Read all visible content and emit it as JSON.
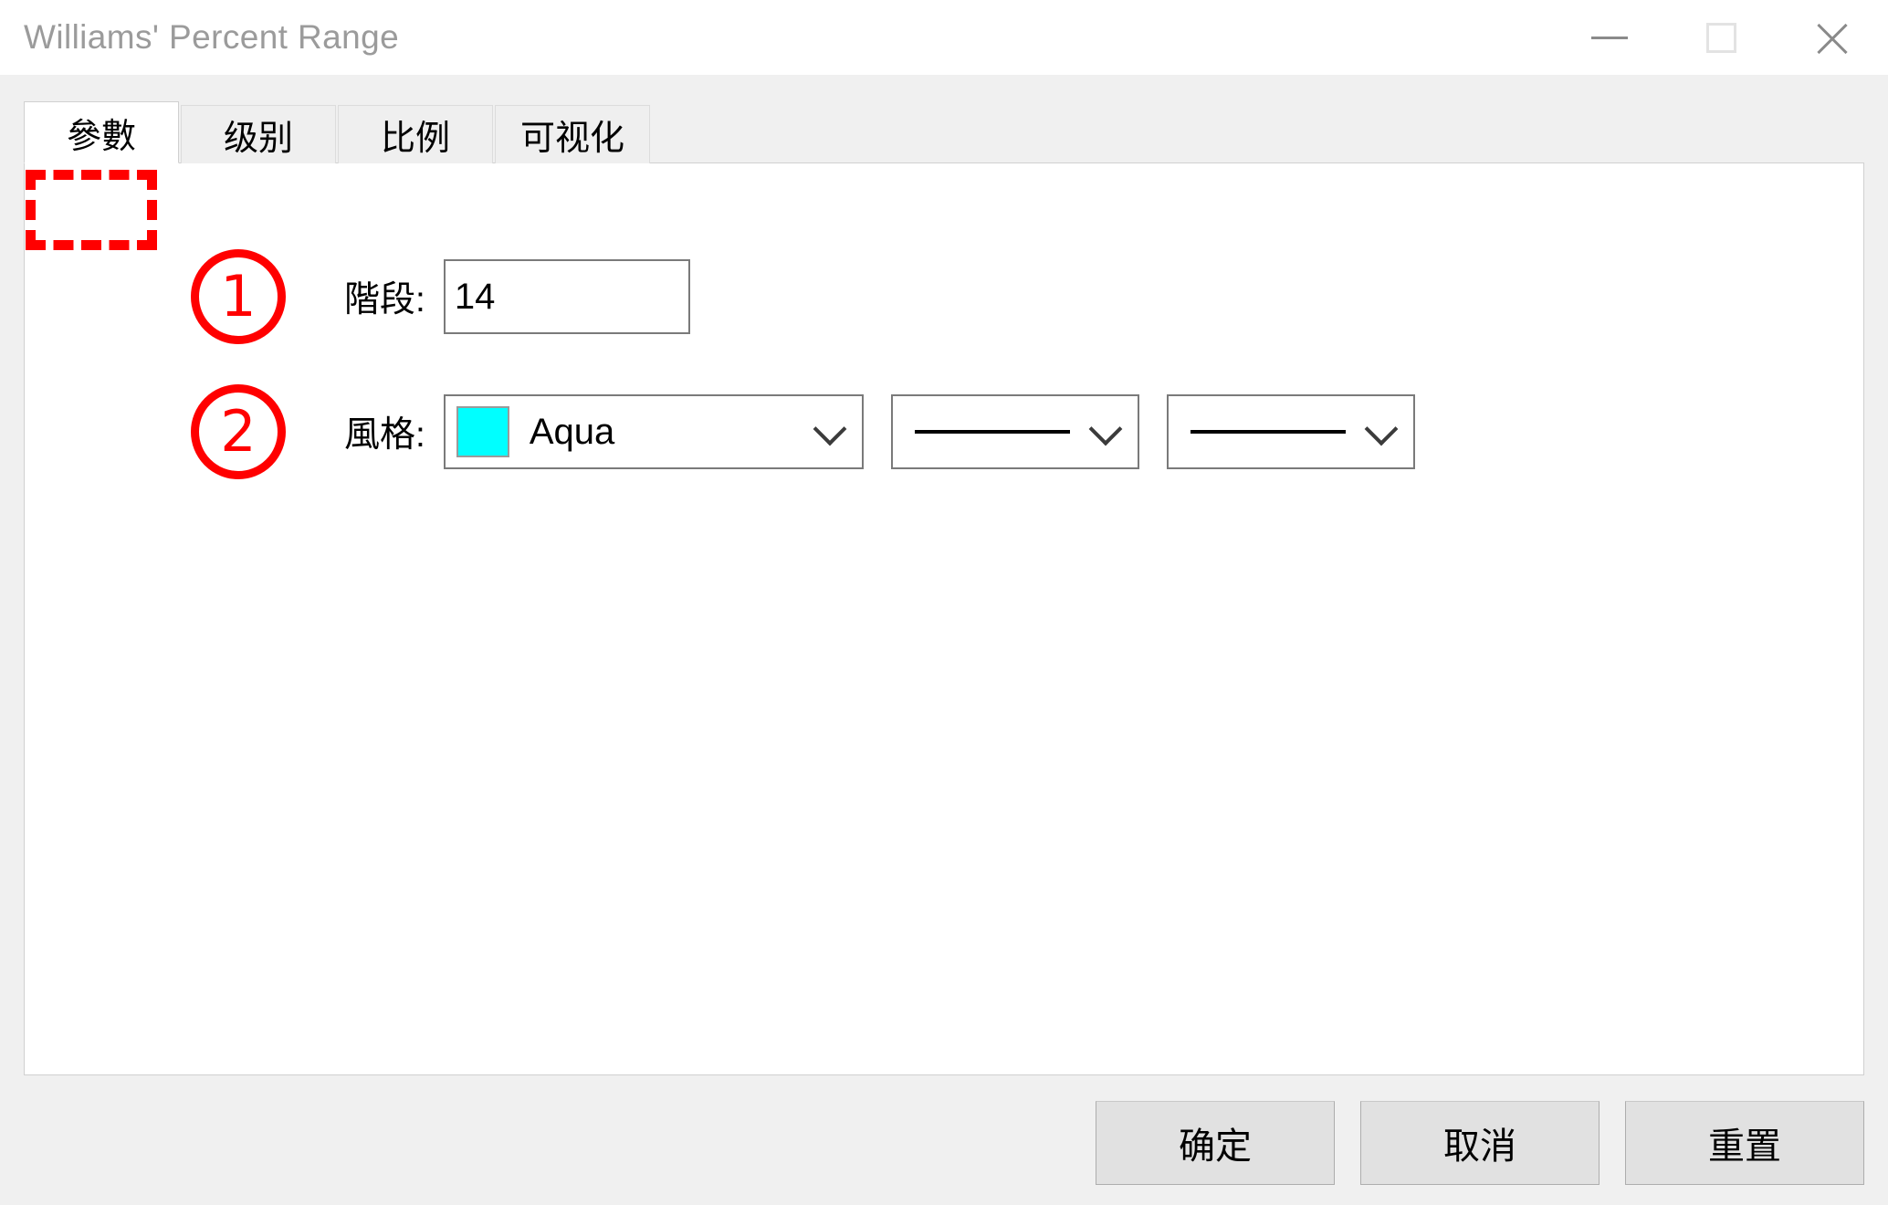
{
  "window": {
    "title": "Williams' Percent Range",
    "controls": {
      "minimize": "minimize-icon",
      "maximize": "maximize-icon",
      "close": "close-icon"
    }
  },
  "tabs": [
    {
      "label": "參數",
      "active": true,
      "annotated": true
    },
    {
      "label": "级别",
      "active": false,
      "annotated": false
    },
    {
      "label": "比例",
      "active": false,
      "annotated": false
    },
    {
      "label": "可视化",
      "active": false,
      "annotated": false
    }
  ],
  "annotations": [
    {
      "marker": "①",
      "number": "1",
      "target": "period-field",
      "color": "#ff0000"
    },
    {
      "marker": "②",
      "number": "2",
      "target": "style-field",
      "color": "#ff0000"
    },
    {
      "marker": "dashed-box",
      "target": "tab-parameters",
      "color": "#ff0000"
    }
  ],
  "form": {
    "period": {
      "badge": "1",
      "label": "階段:",
      "value": "14",
      "placeholder": ""
    },
    "style": {
      "badge": "2",
      "label": "風格:",
      "color_select": {
        "value": "Aqua",
        "swatch_hex": "#00FFFF"
      },
      "line_width_select": {
        "sample": "solid-line",
        "value": ""
      },
      "line_style_select": {
        "sample": "solid-line",
        "value": ""
      }
    }
  },
  "footer": {
    "ok_label": "确定",
    "cancel_label": "取消",
    "reset_label": "重置"
  },
  "colors": {
    "accent_annotation": "#ff0000",
    "aqua": "#00FFFF",
    "title_text": "#9b9b9b",
    "dialog_bg": "#f0f0f0",
    "panel_bg": "#ffffff"
  }
}
